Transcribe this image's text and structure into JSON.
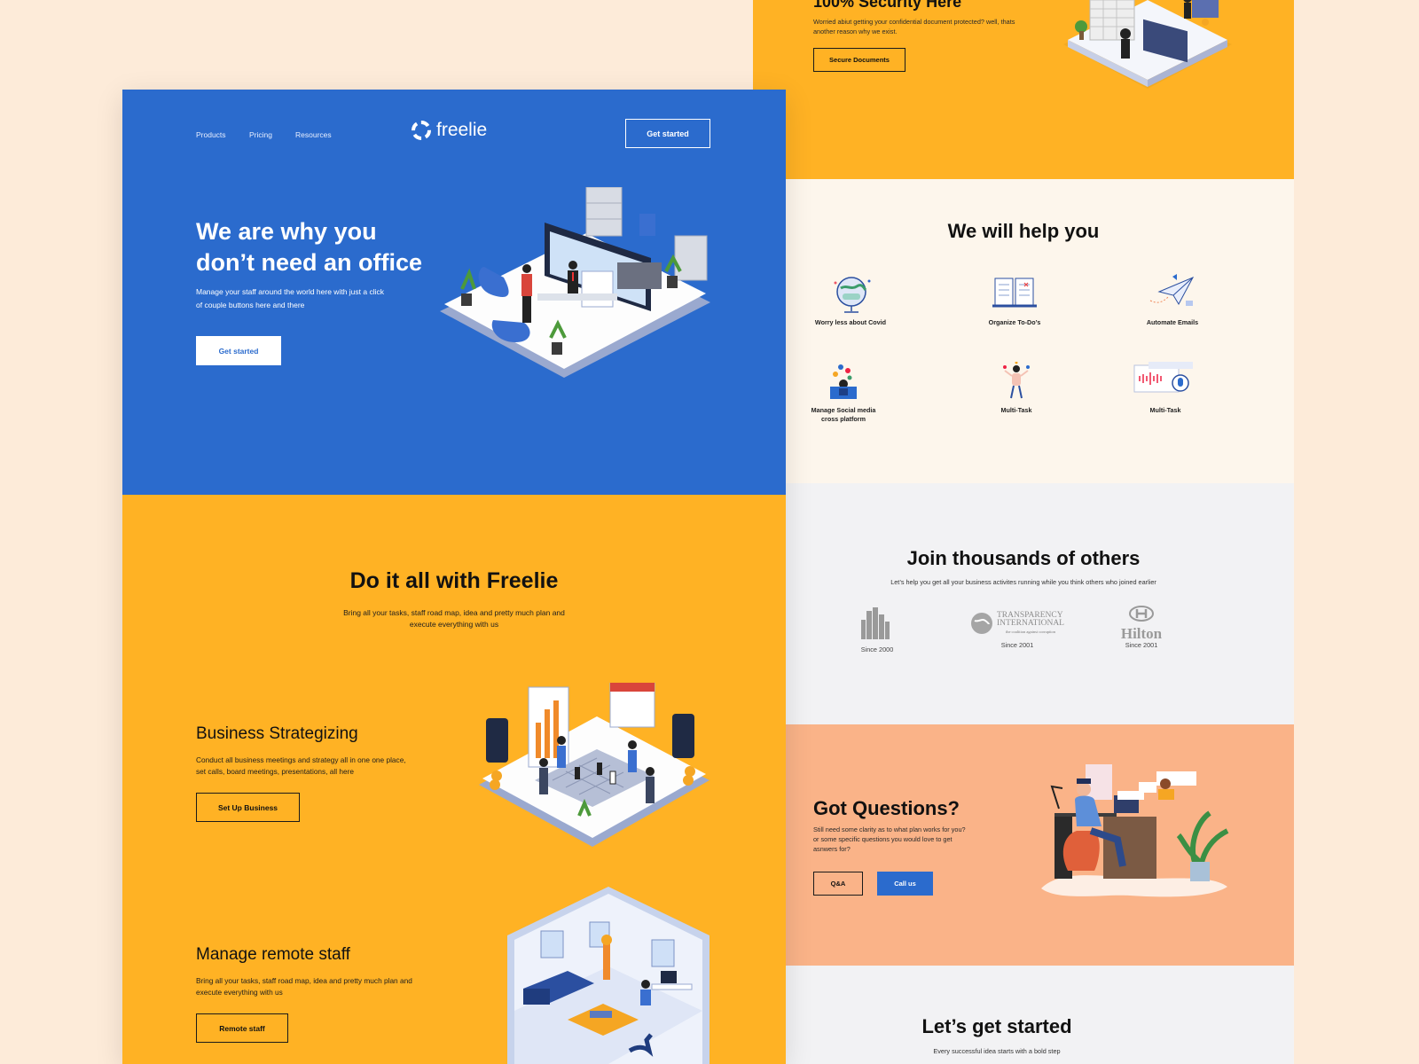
{
  "left": {
    "nav": {
      "items": [
        "Products",
        "Pricing",
        "Resources"
      ],
      "logo_text": "freelie",
      "cta": "Get started"
    },
    "hero": {
      "title_line1": "We are why you",
      "title_line2": "don’t need an office",
      "subtitle_line1": "Manage your staff around the world here with just a click",
      "subtitle_line2": "of couple buttons here and there",
      "cta": "Get started"
    },
    "do_it": {
      "title": "Do it all with Freelie",
      "subtitle_line1": "Bring all your tasks, staff road map, idea and pretty much plan and",
      "subtitle_line2": "execute everything with us"
    },
    "business": {
      "title": "Business Strategizing",
      "text_line1": "Conduct all business meetings and strategy all in one one place,",
      "text_line2": "set calls, board meetings, presentations, all here",
      "cta": "Set Up Business"
    },
    "remote": {
      "title": "Manage remote staff",
      "text_line1": "Bring all your tasks, staff road map, idea and pretty much plan and",
      "text_line2": "execute everything with us",
      "cta": "Remote staff"
    }
  },
  "right": {
    "security": {
      "title": "100% Security Here",
      "text_line1": "Worried abiut getting your confidential document protected? well, thats",
      "text_line2": "another reason why we exist.",
      "cta": "Secure Documents"
    },
    "help": {
      "title": "We will help you",
      "items": [
        {
          "label": "Worry less about Covid",
          "icon": "globe-mask-icon"
        },
        {
          "label": "Organize To-Do’s",
          "icon": "todo-list-icon"
        },
        {
          "label": "Automate Emails",
          "icon": "paper-plane-icon"
        },
        {
          "label_line1": "Manage Social media",
          "label_line2": "cross platform",
          "icon": "social-media-icon"
        },
        {
          "label": "Multi-Task",
          "icon": "juggling-person-icon"
        },
        {
          "label": "Multi-Task",
          "icon": "audio-wave-icon"
        }
      ]
    },
    "join": {
      "title": "Join thousands of others",
      "subtitle": "Let’s help you get all your business activites running while you think others who joined earlier",
      "logos": [
        {
          "since": "Since 2000"
        },
        {
          "name_line1": "TRANSPARENCY",
          "name_line2": "INTERNATIONAL",
          "tagline": "the coalition against corruption",
          "since": "Since 2001"
        },
        {
          "name": "Hilton",
          "since": "Since 2001"
        }
      ]
    },
    "questions": {
      "title": "Got Questions?",
      "text_line1": "Still need some clarity as to what plan works for you?",
      "text_line2": "or some specific questions you would love to get",
      "text_line3": "asnwers for?",
      "btn_qa": "Q&A",
      "btn_call": "Call us"
    },
    "start": {
      "title": "Let’s get started",
      "subtitle": "Every successful idea starts with a bold step"
    }
  },
  "colors": {
    "blue": "#2b6bcd",
    "yellow": "#ffb224",
    "peach": "#fab388",
    "cream": "#fdf6ec",
    "bg": "#fdebd9",
    "grey": "#f2f2f4"
  }
}
